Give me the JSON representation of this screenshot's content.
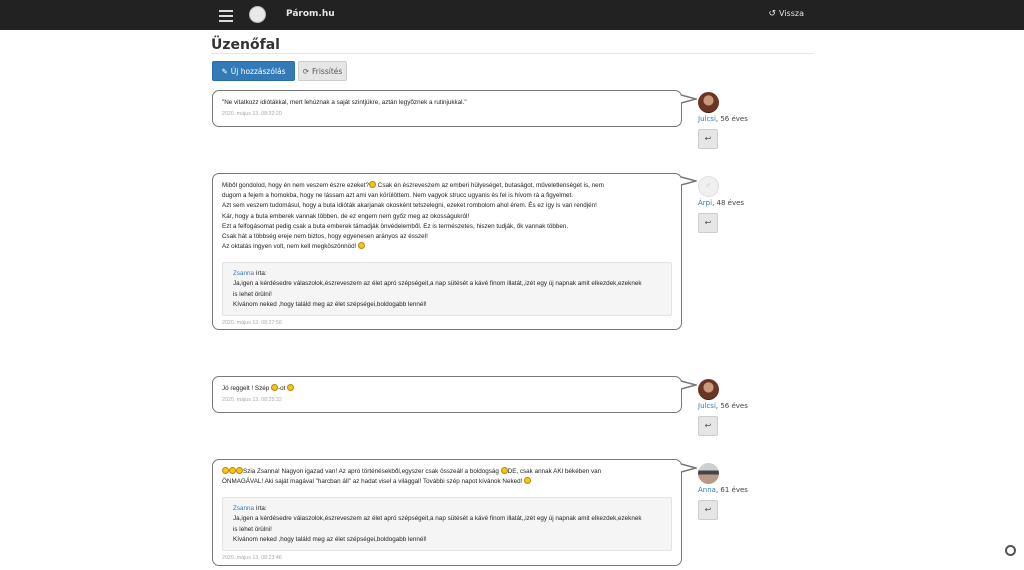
{
  "navbar": {
    "brand": "Párom.hu",
    "back_label": "Vissza"
  },
  "page": {
    "title": "Üzenőfal"
  },
  "toolbar": {
    "new_post_label": "Új hozzászólás",
    "refresh_label": "Frissítés"
  },
  "posts": [
    {
      "text_lines": [
        "\"Ne vitatkozz idiótákkal, mert lehúznak a saját szintjükre, aztán legyőznek a rutinjukkal.\""
      ],
      "time": "2020. május 13. 08:32:20",
      "author": {
        "name": "Julcsi",
        "age": ", 56 éves"
      }
    },
    {
      "text_lines": [
        "Miből gondolod, hogy én nem veszem észre ezeket?",
        " Csak én észreveszem az emberi hülyeséget, butaságot, műveletlenséget is, nem",
        "dugom a fejem a homokba, hogy ne lássam azt ami van körülöttem. Nem vagyok strucc ugyanis és fel is hívom rá a figyelmet.",
        "Azt sem veszem tudomásul, hogy a buta idióták akarjanak okosként tetszelegni, ezeket rombolom ahol érem. És ez így is van rendjén!",
        "Kár, hogy a buta emberek vannak többen, de ez engem nem győz meg az okosságukról!",
        "Ezt a felfogásomat pedig csak a buta emberek támadják önvédelemből. Ez is természetes, hiszen tudják, ők vannak többen.",
        "Csak hát a többség ereje nem biztos, hogy egyenesen arányos az ésszel!",
        "Az oktatás ingyen volt, nem kell megköszönnöd!"
      ],
      "quote": {
        "author": "Zsanna",
        "wrote": " írta:",
        "lines": [
          "Ja,igen a kérdésedre válaszolok,észreveszem az élet apró szépségeit,a nap sütését a kávé finom illatát,,izét egy új napnak amit elkezdek,ezeknek",
          "is lehet örülni!",
          "Kívánom neked ,hogy találd meg az élet szépségei,boldogabb lennél!"
        ]
      },
      "time": "2020. május 13. 08:27:56",
      "author": {
        "name": "Árpi",
        "age": ", 48 éves"
      }
    },
    {
      "text_lines": [
        "Jó reggelt ! Szép",
        "-ot"
      ],
      "time": "2020. május 13. 08:25:32",
      "author": {
        "name": "Julcsi",
        "age": ", 56 éves"
      }
    },
    {
      "text_lines": [
        "Szia Zsanna! Nagyon igazad van! Az apró történésekből,egyszer csak összeáll a boldogság",
        "DE, csak annak AKI békében van",
        "ÖNMAGÁVAL! Aki saját magával \"harcban áll\" az hadat visel a világgal! További szép napot kívánok Neked!"
      ],
      "quote": {
        "author": "Zsanna",
        "wrote": " írta:",
        "lines": [
          "Ja,igen a kérdésedre válaszolok,észreveszem az élet apró szépségeit,a nap sütését a kávé finom illatát,,izét egy új napnak amit elkezdek,ezeknek",
          "is lehet örülni!",
          "Kívánom neked ,hogy találd meg az élet szépségei,boldogabb lennél!"
        ]
      },
      "time": "2020. május 13. 08:23:46",
      "author": {
        "name": "Anna",
        "age": ", 61 éves"
      }
    }
  ]
}
